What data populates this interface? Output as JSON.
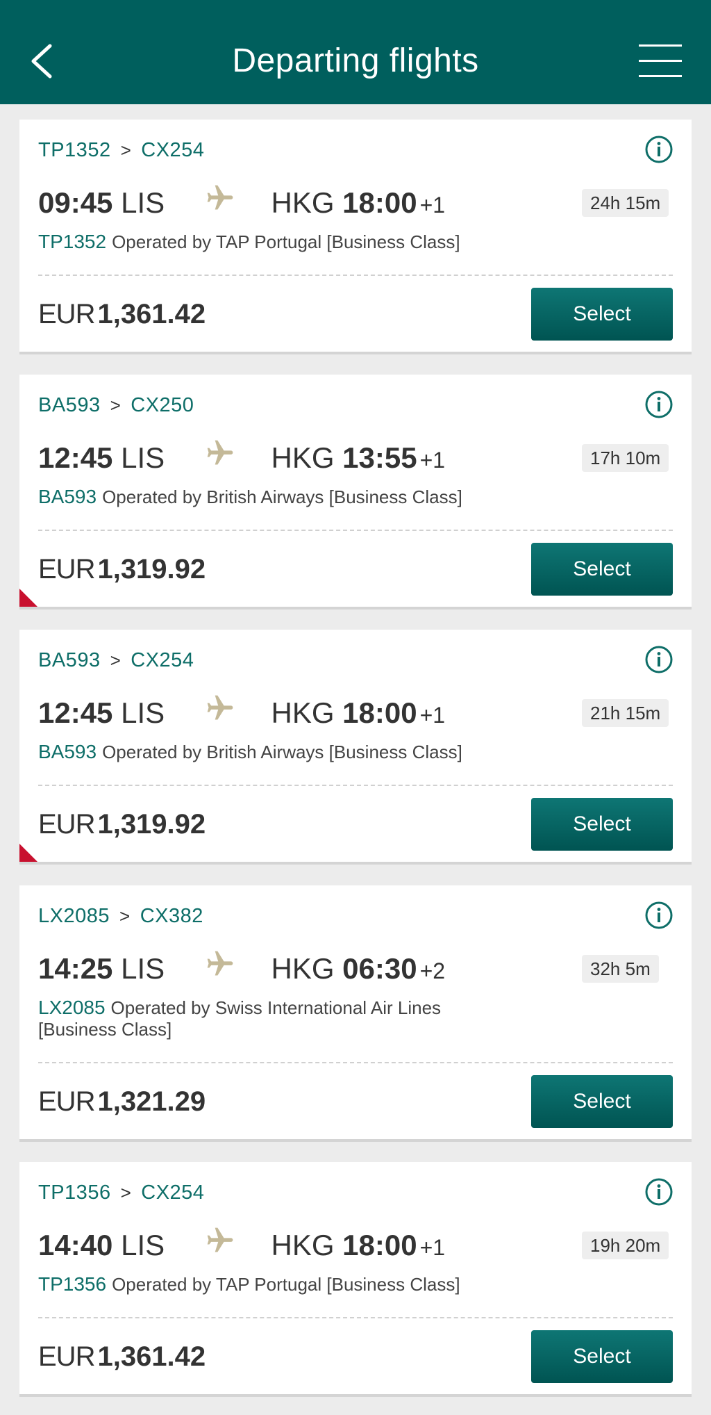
{
  "header": {
    "title": "Departing flights"
  },
  "flights": [
    {
      "route_from": "TP1352",
      "route_to": "CX254",
      "separator": ">",
      "dep_time": "09:45",
      "dep_airport": "LIS",
      "arr_airport": "HKG",
      "arr_time": "18:00",
      "day_offset": "+1",
      "duration": "24h 15m",
      "flight_no": "TP1352",
      "operated_by": "Operated by TAP Portugal [Business Class]",
      "currency": "EUR",
      "price": "1,361.42",
      "select_label": "Select"
    },
    {
      "route_from": "BA593",
      "route_to": "CX250",
      "separator": ">",
      "dep_time": "12:45",
      "dep_airport": "LIS",
      "arr_airport": "HKG",
      "arr_time": "13:55",
      "day_offset": "+1",
      "duration": "17h 10m",
      "flight_no": "BA593",
      "operated_by": "Operated by British Airways [Business Class]",
      "currency": "EUR",
      "price": "1,319.92",
      "select_label": "Select"
    },
    {
      "route_from": "BA593",
      "route_to": "CX254",
      "separator": ">",
      "dep_time": "12:45",
      "dep_airport": "LIS",
      "arr_airport": "HKG",
      "arr_time": "18:00",
      "day_offset": "+1",
      "duration": "21h 15m",
      "flight_no": "BA593",
      "operated_by": "Operated by British Airways [Business Class]",
      "currency": "EUR",
      "price": "1,319.92",
      "select_label": "Select"
    },
    {
      "route_from": "LX2085",
      "route_to": "CX382",
      "separator": ">",
      "dep_time": "14:25",
      "dep_airport": "LIS",
      "arr_airport": "HKG",
      "arr_time": "06:30",
      "day_offset": "+2",
      "duration": "32h 5m",
      "flight_no": "LX2085",
      "operated_by": "Operated by Swiss International Air Lines [Business Class]",
      "currency": "EUR",
      "price": "1,321.29",
      "select_label": "Select"
    },
    {
      "route_from": "TP1356",
      "route_to": "CX254",
      "separator": ">",
      "dep_time": "14:40",
      "dep_airport": "LIS",
      "arr_airport": "HKG",
      "arr_time": "18:00",
      "day_offset": "+1",
      "duration": "19h 20m",
      "flight_no": "TP1356",
      "operated_by": "Operated by TAP Portugal [Business Class]",
      "currency": "EUR",
      "price": "1,361.42",
      "select_label": "Select"
    }
  ],
  "colors": {
    "header_bg": "#005f5d",
    "accent_teal": "#0e6e68",
    "button_bg": "#00625f",
    "flag_red": "#c8102e",
    "page_bg": "#ececec"
  },
  "icons": {
    "back": "chevron-left-icon",
    "menu": "hamburger-menu-icon",
    "info": "info-icon",
    "plane": "airplane-icon",
    "flag": "corner-flag-icon"
  }
}
